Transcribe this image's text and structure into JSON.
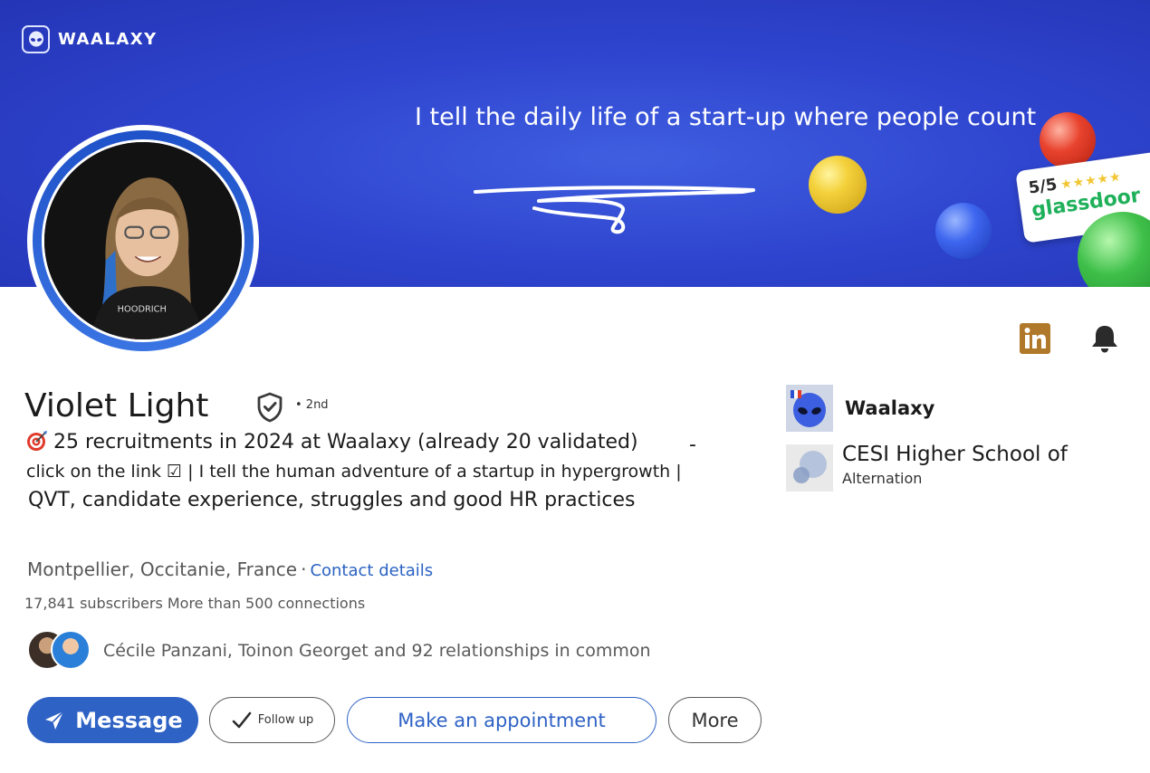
{
  "banner": {
    "brand_name": "WAALAXY",
    "tagline": "I tell the daily life of a start-up where people count",
    "rating": {
      "score": "5/5",
      "stars": "★★★★★",
      "site": "glassdoor"
    }
  },
  "profile": {
    "name": "Violet Light",
    "degree": "• 2nd",
    "headline": {
      "line1": "25 recruitments in 2024 at Waalaxy (already 20 validated)",
      "line1_suffix": "-",
      "line2": "click on the link ☑ | I tell the human adventure of a startup in hypergrowth |",
      "line3": "QVT, candidate experience, struggles and good HR practices"
    },
    "location": "Montpellier, Occitanie, France",
    "location_separator": "·",
    "contact_link": "Contact details",
    "stats": "17,841 subscribers More than 500 connections",
    "mutual": "Cécile Panzani, Toinon Georget and 92 relationships in common"
  },
  "actions": {
    "message": "Message",
    "follow": "Follow up",
    "appointment": "Make an appointment",
    "more": "More"
  },
  "experience": [
    {
      "name": "Waalaxy"
    },
    {
      "name": "CESI Higher School of",
      "sub": "Alternation"
    }
  ],
  "colors": {
    "banner": "#2f45cf",
    "primary": "#2e62c5",
    "linkedin_badge": "#b0782a"
  }
}
